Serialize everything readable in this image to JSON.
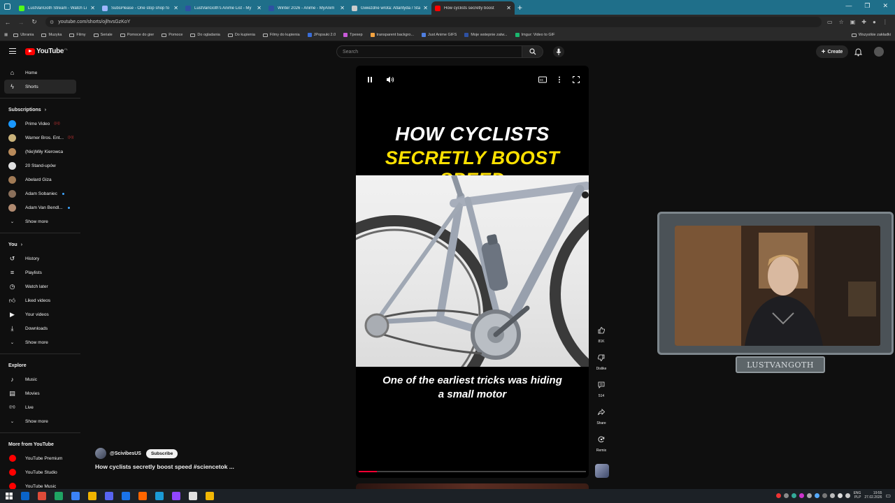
{
  "browser": {
    "tabs": [
      {
        "title": "LustVanGoth Stream - Watch Li",
        "favicon_color": "#53fc18",
        "active": false
      },
      {
        "title": "SubsPlease - One stop shop fo",
        "favicon_color": "#9fb6ff",
        "active": false
      },
      {
        "title": "LustVanGoth's Anime List - My",
        "favicon_color": "#2e51a2",
        "active": false
      },
      {
        "title": "Winter 2026 - Anime - MyAnim",
        "favicon_color": "#2e51a2",
        "active": false
      },
      {
        "title": "Gwiezdne wrota: Atlantyda / Sta",
        "favicon_color": "#cccccc",
        "active": false
      },
      {
        "title": "How cyclists secretly boost",
        "favicon_color": "#ff0000",
        "active": true
      }
    ],
    "url": "youtube.com/shorts/ojlhvsGzKoY",
    "bookmarks": [
      {
        "label": "Ubrania",
        "type": "folder"
      },
      {
        "label": "Muzyka",
        "type": "folder"
      },
      {
        "label": "Filmy",
        "type": "folder"
      },
      {
        "label": "Seriale",
        "type": "folder"
      },
      {
        "label": "Pomoce do gier",
        "type": "folder"
      },
      {
        "label": "Pomoce",
        "type": "folder"
      },
      {
        "label": "Do ogladania",
        "type": "folder"
      },
      {
        "label": "Do kupienia",
        "type": "folder"
      },
      {
        "label": "Filmy do kupienia",
        "type": "folder"
      },
      {
        "label": "JPopsuki 2.0",
        "type": "site",
        "color": "#3a6ed8"
      },
      {
        "label": "Tpexep",
        "type": "site",
        "color": "#c85ad8"
      },
      {
        "label": "transparent backgro...",
        "type": "site",
        "color": "#f4a340"
      },
      {
        "label": "Just Anime GIFS",
        "type": "site",
        "color": "#4f7fe0"
      },
      {
        "label": "Moje wstepnie zatw...",
        "type": "site",
        "color": "#2e51a2"
      },
      {
        "label": "Imgur: Video to GIF",
        "type": "site",
        "color": "#1bb76e"
      }
    ],
    "bookmarks_right": "Wszystkie zakładki"
  },
  "masthead": {
    "logo_text": "YouTube",
    "country_code": "PL",
    "search_placeholder": "Search",
    "create_label": "Create"
  },
  "sidebar": {
    "main": [
      {
        "label": "Home",
        "icon": "home-icon",
        "active": false
      },
      {
        "label": "Shorts",
        "icon": "shorts-icon",
        "active": true
      }
    ],
    "subscriptions_title": "Subscriptions",
    "subscriptions": [
      {
        "label": "Prime Video",
        "color": "#1a98ff",
        "badge": "live"
      },
      {
        "label": "Warner Bros. Ent...",
        "color": "#c9b27a",
        "badge": "live"
      },
      {
        "label": "(Nie)Miły Kierowca",
        "color": "#b88a5a",
        "badge": ""
      },
      {
        "label": "20 Stand-upów",
        "color": "#e0e0e0",
        "badge": ""
      },
      {
        "label": "Abelard Giza",
        "color": "#a07a55",
        "badge": ""
      },
      {
        "label": "Adam Sobaniec",
        "color": "#8a6f5a",
        "badge": "new"
      },
      {
        "label": "Adam Van Bendl...",
        "color": "#b08a70",
        "badge": "new"
      }
    ],
    "show_more": "Show more",
    "you_title": "You",
    "you": [
      {
        "label": "History",
        "icon": "history-icon"
      },
      {
        "label": "Playlists",
        "icon": "playlists-icon"
      },
      {
        "label": "Watch later",
        "icon": "watch-later-icon"
      },
      {
        "label": "Liked videos",
        "icon": "liked-videos-icon"
      },
      {
        "label": "Your videos",
        "icon": "your-videos-icon"
      },
      {
        "label": "Downloads",
        "icon": "downloads-icon"
      }
    ],
    "explore_title": "Explore",
    "explore": [
      {
        "label": "Music",
        "icon": "music-icon"
      },
      {
        "label": "Movies",
        "icon": "movies-icon"
      },
      {
        "label": "Live",
        "icon": "live-icon"
      }
    ],
    "more_title": "More from YouTube",
    "more": [
      {
        "label": "YouTube Premium",
        "color": "#ff0000"
      },
      {
        "label": "YouTube Studio",
        "color": "#ff0000"
      },
      {
        "label": "YouTube Music",
        "color": "#ff0000"
      }
    ]
  },
  "video": {
    "title_line1": "HOW CYCLISTS",
    "title_line2": "SECRETLY BOOST SPEED",
    "caption_line1": "One of the earliest tricks was hiding",
    "caption_line2": "a small motor",
    "progress": 0.08
  },
  "actions": {
    "like_count": "81K",
    "dislike_label": "Dislike",
    "comment_count": "514",
    "share_label": "Share",
    "remix_label": "Remix"
  },
  "channel": {
    "handle": "@ScivibesUS",
    "subscribe_label": "Subscribe",
    "description": "How cyclists secretly boost speed #sciencetok ..."
  },
  "webcam": {
    "streamer_name": "LUSTVANGOTH"
  },
  "taskbar": {
    "icons": [
      "#0a64c8",
      "#dd4b39",
      "#1fa463",
      "#3b82f6",
      "#f0b400",
      "#5865f2",
      "#1a73e8",
      "#ff6600",
      "#1b9bd7",
      "#9146ff",
      "#e0e0e0",
      "#f2b705"
    ],
    "lang_top": "ENG",
    "lang_bottom": "PLP",
    "time": "19:55",
    "date": "27.02.2026"
  }
}
